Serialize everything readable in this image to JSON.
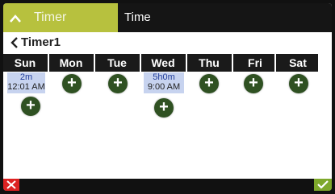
{
  "header": {
    "active_tab_label": "Timer",
    "inactive_tab_label": "Time"
  },
  "title": "Timer1",
  "days": [
    "Sun",
    "Mon",
    "Tue",
    "Wed",
    "Thu",
    "Fri",
    "Sat"
  ],
  "timers": {
    "sun": {
      "duration": "2m",
      "time": "12:01 AM"
    },
    "wed": {
      "duration": "5h0m",
      "time": "9:00 AM"
    }
  },
  "add_symbol": "+",
  "colors": {
    "accent": "#b7c13e",
    "header_bg": "#151515",
    "add_button": "#2f5122",
    "timer_block": "#c7d3ef",
    "cancel": "#dd2222",
    "confirm": "#7ea82b"
  },
  "icons": [
    "chevron-up-icon",
    "back-arrow-icon",
    "plus-icon",
    "close-icon",
    "check-icon"
  ]
}
